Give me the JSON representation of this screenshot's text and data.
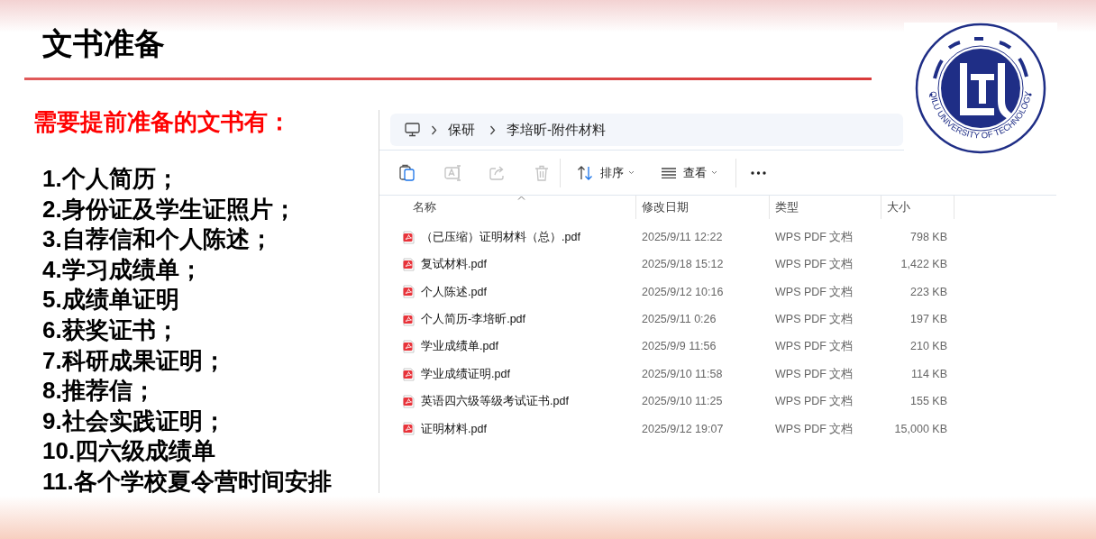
{
  "slide": {
    "title": "文书准备",
    "subtitle": "需要提前准备的文书有：",
    "items": [
      "1.个人简历；",
      "2.身份证及学生证照片；",
      "3.自荐信和个人陈述；",
      "4.学习成绩单；",
      "5.成绩单证明",
      "6.获奖证书；",
      "7.科研成果证明；",
      "8.推荐信；",
      "9.社会实践证明；",
      "10.四六级成绩单",
      "11.各个学校夏令营时间安排"
    ]
  },
  "logo": {
    "text": "QILU UNIVERSITY OF TECHNOLOGY"
  },
  "explorer": {
    "breadcrumb": [
      "保研",
      "李培昕-附件材料"
    ],
    "toolbar": [
      {
        "kind": "copy",
        "disabled": false
      },
      {
        "kind": "rename",
        "disabled": true
      },
      {
        "kind": "share",
        "disabled": true
      },
      {
        "kind": "delete",
        "disabled": true
      },
      {
        "kind": "sort",
        "label": "排序"
      },
      {
        "kind": "view",
        "label": "查看"
      },
      {
        "kind": "more"
      }
    ],
    "columns": [
      "名称",
      "修改日期",
      "类型",
      "大小"
    ],
    "files": [
      {
        "name": "（已压缩）证明材料（总）.pdf",
        "modified": "2025/9/11 12:22",
        "type": "WPS PDF 文档",
        "size": "798 KB"
      },
      {
        "name": "复试材料.pdf",
        "modified": "2025/9/18 15:12",
        "type": "WPS PDF 文档",
        "size": "1,422 KB"
      },
      {
        "name": "个人陈述.pdf",
        "modified": "2025/9/12 10:16",
        "type": "WPS PDF 文档",
        "size": "223 KB"
      },
      {
        "name": "个人简历-李培昕.pdf",
        "modified": "2025/9/11 0:26",
        "type": "WPS PDF 文档",
        "size": "197 KB"
      },
      {
        "name": "学业成绩单.pdf",
        "modified": "2025/9/9 11:56",
        "type": "WPS PDF 文档",
        "size": "210 KB"
      },
      {
        "name": "学业成绩证明.pdf",
        "modified": "2025/9/10 11:58",
        "type": "WPS PDF 文档",
        "size": "114 KB"
      },
      {
        "name": "英语四六级等级考试证书.pdf",
        "modified": "2025/9/10 11:25",
        "type": "WPS PDF 文档",
        "size": "155 KB"
      },
      {
        "name": "证明材料.pdf",
        "modified": "2025/9/12 19:07",
        "type": "WPS PDF 文档",
        "size": "15,000 KB"
      }
    ]
  }
}
